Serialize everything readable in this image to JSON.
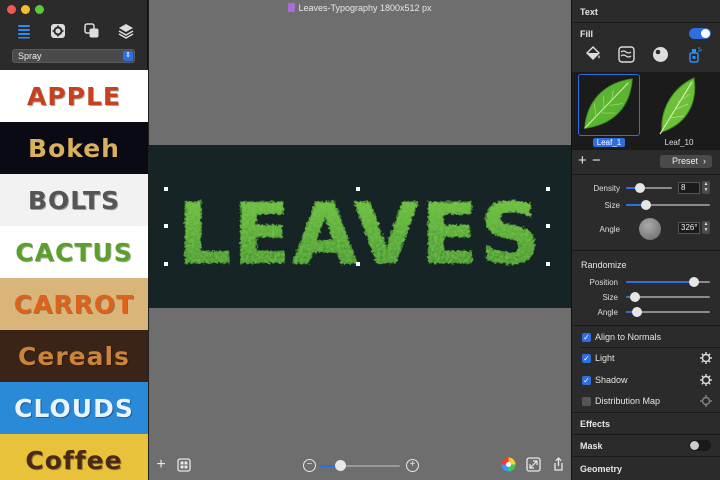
{
  "window": {
    "title": "Leaves-Typography 1800x512 px",
    "canvas_text": "LEAVES"
  },
  "left_panel": {
    "tool_icons": [
      "list-icon",
      "gear-icon",
      "overlap-squares-icon",
      "layers-icon"
    ],
    "selected_tool": "list-icon",
    "category": "Spray",
    "presets": [
      {
        "label": "APPLE",
        "bg": "#ffffff",
        "fg": "#c8401e"
      },
      {
        "label": "Bokeh",
        "bg": "#0a0a14",
        "fg": "#d8b060"
      },
      {
        "label": "BOLTS",
        "bg": "#f2f2f2",
        "fg": "#555555"
      },
      {
        "label": "CACTUS",
        "bg": "#ffffff",
        "fg": "#5aa02a"
      },
      {
        "label": "CARROT",
        "bg": "#d9b57a",
        "fg": "#e0621a"
      },
      {
        "label": "Cereals",
        "bg": "#3a2418",
        "fg": "#c9843a"
      },
      {
        "label": "CLOUDS",
        "bg": "#2a8ad8",
        "fg": "#e8f4ff"
      },
      {
        "label": "Coffee",
        "bg": "#e8c23a",
        "fg": "#4a2a12"
      }
    ]
  },
  "bottom_toolbar": {
    "add_icon": "plus-icon",
    "grid_icon": "grid-icon",
    "zoom_out_icon": "zoom-out-icon",
    "zoom_in_icon": "zoom-in-icon",
    "zoom_level": 0.22,
    "color_wheel_icon": "color-wheel-icon",
    "resize_icon": "resize-icon",
    "share_icon": "share-icon"
  },
  "inspector": {
    "text_header": "Text",
    "fill_label": "Fill",
    "fill_enabled": true,
    "fill_tools": [
      "paint-bucket-icon",
      "texture-icon",
      "sphere-icon",
      "spray-icon"
    ],
    "active_fill_tool": "spray-icon",
    "leaves": [
      {
        "label": "Leaf_1",
        "selected": true
      },
      {
        "label": "Leaf_10",
        "selected": false
      }
    ],
    "preset_button": "Preset",
    "density": {
      "label": "Density",
      "value": "8",
      "level": 0.25
    },
    "size": {
      "label": "Size",
      "level": 0.2
    },
    "angle": {
      "label": "Angle",
      "value": "326°"
    },
    "randomize_header": "Randomize",
    "rand_position": {
      "label": "Position",
      "level": 0.85
    },
    "rand_size": {
      "label": "Size",
      "level": 0.05
    },
    "rand_angle": {
      "label": "Angle",
      "level": 0.08
    },
    "align_to_normals": {
      "label": "Align to Normals",
      "checked": true
    },
    "light": {
      "label": "Light",
      "checked": true
    },
    "shadow": {
      "label": "Shadow",
      "checked": true
    },
    "distribution_map": {
      "label": "Distribution Map",
      "checked": false
    },
    "effects_header": "Effects",
    "mask_label": "Mask",
    "mask_enabled": false,
    "geometry_header": "Geometry"
  },
  "colors": {
    "accent": "#2f6ee0",
    "leaf_green": "#3e9a26",
    "canvas_bg": "#172425"
  }
}
